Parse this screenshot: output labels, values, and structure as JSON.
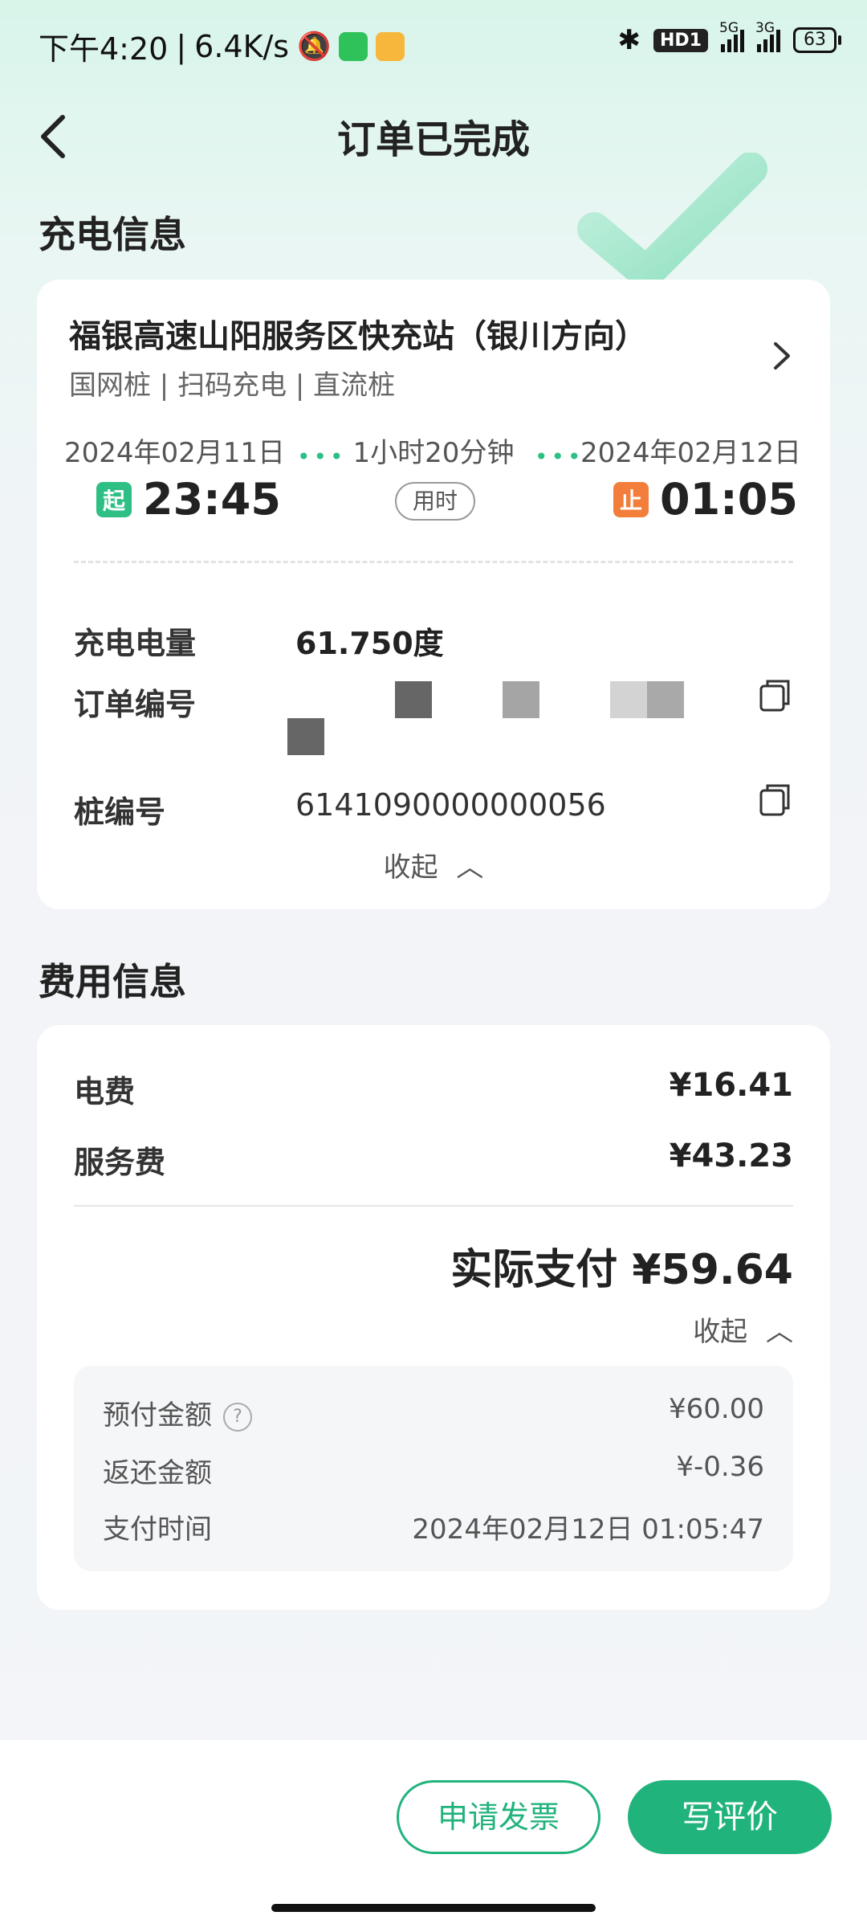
{
  "status_bar": {
    "time": "下午4:20",
    "speed": "6.4K/s",
    "hd_label": "HD1",
    "network_1": "5G",
    "network_2": "3G",
    "battery": "63"
  },
  "header": {
    "title": "订单已完成"
  },
  "charging_section": {
    "title": "充电信息",
    "station_name": "福银高速山阳服务区快充站（银川方向）",
    "station_tags": "国网桩 | 扫码充电 | 直流桩",
    "start_date": "2024年02月11日",
    "start_badge": "起",
    "start_time": "23:45",
    "duration": "1小时20分钟",
    "duration_label": "用时",
    "end_date": "2024年02月12日",
    "end_badge": "止",
    "end_time": "01:05",
    "energy_label": "充电电量",
    "energy_value": "61.750度",
    "order_label": "订单编号",
    "pile_label": "桩编号",
    "pile_value": "6141090000000056",
    "collapse_label": "收起"
  },
  "fee_section": {
    "title": "费用信息",
    "electricity_label": "电费",
    "electricity_value": "¥16.41",
    "service_label": "服务费",
    "service_value": "¥43.23",
    "total_label": "实际支付",
    "total_value": "¥59.64",
    "collapse_label": "收起",
    "prepaid_label": "预付金额",
    "prepaid_value": "¥60.00",
    "refund_label": "返还金额",
    "refund_value": "¥-0.36",
    "pay_time_label": "支付时间",
    "pay_time_value": "2024年02月12日 01:05:47"
  },
  "actions": {
    "invoice_label": "申请发票",
    "review_label": "写评价"
  },
  "colors": {
    "brand_green": "#21b37c",
    "start_badge": "#2ebf85",
    "stop_badge": "#f37d3a"
  }
}
